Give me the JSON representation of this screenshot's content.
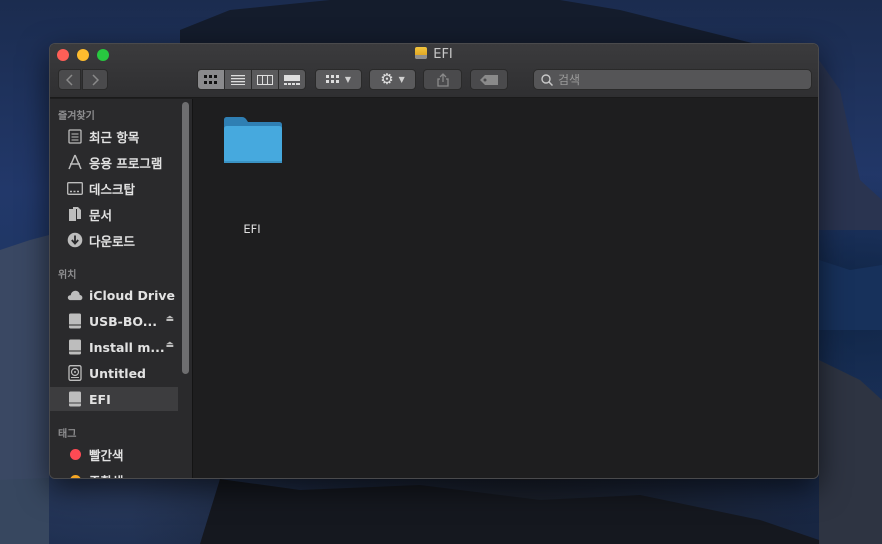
{
  "window": {
    "title": "EFI"
  },
  "toolbar": {
    "back_icon": "chevron-left-icon",
    "forward_icon": "chevron-right-icon",
    "view_modes": [
      "icon-view-icon",
      "list-view-icon",
      "column-view-icon",
      "gallery-view-icon"
    ],
    "group_icon": "group-grid-icon",
    "action_icon": "gear-icon",
    "share_icon": "share-icon",
    "tags_icon": "tag-icon",
    "search_placeholder": "검색"
  },
  "sidebar": {
    "favorites_title": "즐겨찾기",
    "favorites": [
      {
        "label": "최근 항목",
        "icon": "recents-icon"
      },
      {
        "label": "응용 프로그램",
        "icon": "applications-icon"
      },
      {
        "label": "데스크탑",
        "icon": "desktop-icon"
      },
      {
        "label": "문서",
        "icon": "documents-icon"
      },
      {
        "label": "다운로드",
        "icon": "downloads-icon"
      }
    ],
    "locations_title": "위치",
    "locations": [
      {
        "label": "iCloud Drive",
        "icon": "cloud-icon"
      },
      {
        "label": "USB-BO...",
        "icon": "drive-icon",
        "eject": true
      },
      {
        "label": "Install m...",
        "icon": "drive-icon",
        "eject": true
      },
      {
        "label": "Untitled",
        "icon": "disk-icon"
      },
      {
        "label": "EFI",
        "icon": "drive-icon",
        "selected": true
      }
    ],
    "tags_title": "태그",
    "tags": [
      {
        "label": "빨간색",
        "color": "#fe4a54"
      },
      {
        "label": "주황색",
        "color": "#f5a623"
      }
    ]
  },
  "content": {
    "items": [
      {
        "name": "EFI",
        "type": "folder",
        "color": "#46a9de"
      }
    ]
  }
}
